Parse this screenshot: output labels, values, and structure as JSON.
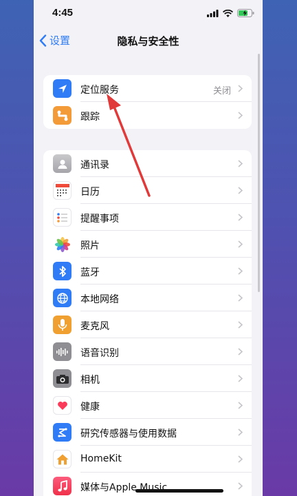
{
  "status": {
    "time": "4:45"
  },
  "nav": {
    "back_label": "设置",
    "title": "隐私与安全性"
  },
  "group1": [
    {
      "label": "定位服务",
      "value": "关闭",
      "icon": "location-arrow-icon",
      "color": "#2f7cf6"
    },
    {
      "label": "跟踪",
      "icon": "tracking-icon",
      "color": "#f29b38"
    }
  ],
  "group2": [
    {
      "label": "通讯录",
      "icon": "contacts-icon",
      "color": "#a8a8ad"
    },
    {
      "label": "日历",
      "icon": "calendar-icon",
      "color": "#ffffff"
    },
    {
      "label": "提醒事项",
      "icon": "reminders-icon",
      "color": "#ffffff"
    },
    {
      "label": "照片",
      "icon": "photos-icon",
      "color": "#ffffff"
    },
    {
      "label": "蓝牙",
      "icon": "bluetooth-icon",
      "color": "#2f7cf6"
    },
    {
      "label": "本地网络",
      "icon": "globe-icon",
      "color": "#2f7cf6"
    },
    {
      "label": "麦克风",
      "icon": "microphone-icon",
      "color": "#f0a030"
    },
    {
      "label": "语音识别",
      "icon": "waveform-icon",
      "color": "#8e8e93"
    },
    {
      "label": "相机",
      "icon": "camera-icon",
      "color": "#8e8e93"
    },
    {
      "label": "健康",
      "icon": "heart-icon",
      "color": "#ffffff"
    },
    {
      "label": "研究传感器与使用数据",
      "icon": "research-icon",
      "color": "#2f7cf6"
    },
    {
      "label": "HomeKit",
      "icon": "home-icon",
      "color": "#f0a030"
    },
    {
      "label": "媒体与Apple Music",
      "icon": "music-icon",
      "color": "#fa3c5a"
    }
  ],
  "annotation": {
    "color": "#e03a3a"
  }
}
